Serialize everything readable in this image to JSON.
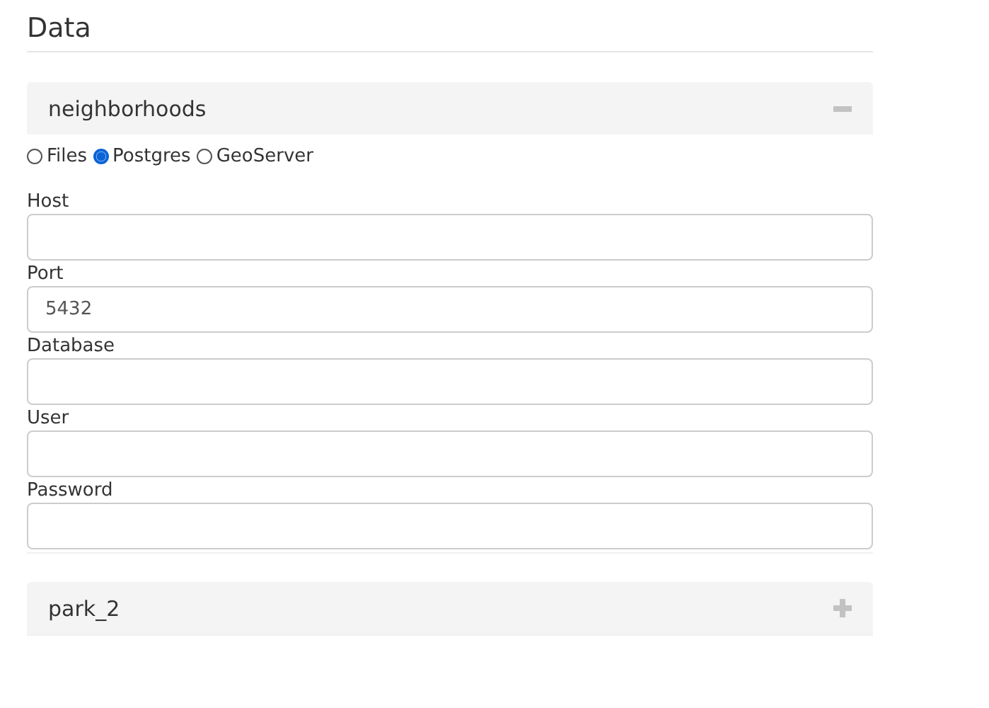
{
  "heading": "Data",
  "sources": [
    {
      "name": "neighborhoods",
      "expanded": true,
      "source_types": [
        {
          "label": "Files",
          "selected": false
        },
        {
          "label": "Postgres",
          "selected": true
        },
        {
          "label": "GeoServer",
          "selected": false
        }
      ],
      "fields": [
        {
          "label": "Host"
        },
        {
          "label": "Port",
          "value": "5432"
        },
        {
          "label": "Database"
        },
        {
          "label": "User"
        },
        {
          "label": "Password"
        }
      ]
    },
    {
      "name": "park_2",
      "expanded": false
    }
  ]
}
